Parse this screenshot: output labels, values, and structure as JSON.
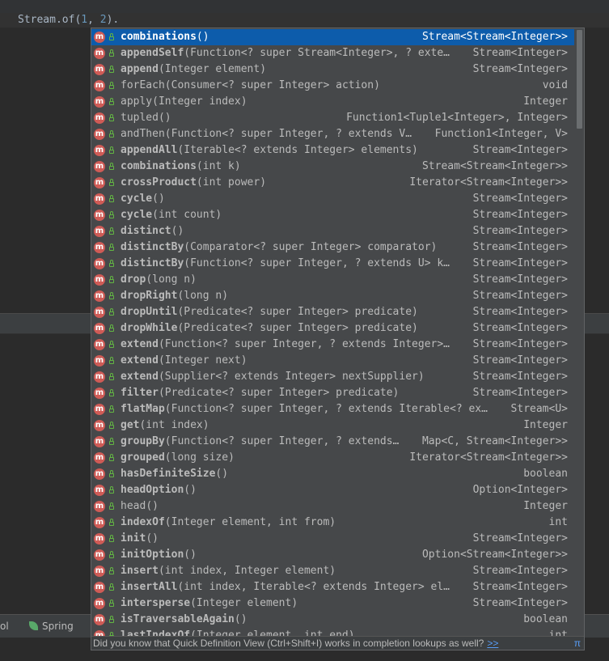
{
  "editor": {
    "code_prefix": "Stream.of(",
    "arg1": "1",
    "sep": ", ",
    "arg2": "2",
    "code_suffix": ")."
  },
  "bottom_tabs": [
    {
      "label": "ol"
    },
    {
      "label": "Spring",
      "icon": "spring-leaf-icon"
    }
  ],
  "completion": {
    "items": [
      {
        "name": "combinations",
        "params": "()",
        "ret": "Stream<Stream<Integer>>",
        "selected": true
      },
      {
        "name": "appendSelf",
        "params": "(Function<? super Stream<Integer>, ? exte…",
        "ret": "Stream<Integer>"
      },
      {
        "name": "append",
        "params": "(Integer element)",
        "ret": "Stream<Integer>"
      },
      {
        "name": "forEach",
        "params": "(Consumer<? super Integer> action)",
        "ret": "void",
        "plain": true
      },
      {
        "name": "apply",
        "params": "(Integer index)",
        "ret": "Integer",
        "plain": true
      },
      {
        "name": "tupled",
        "params": "()",
        "ret": "Function1<Tuple1<Integer>, Integer>",
        "plain": true
      },
      {
        "name": "andThen",
        "params": "(Function<? super Integer, ? extends V…",
        "ret": "Function1<Integer, V>",
        "plain": true
      },
      {
        "name": "appendAll",
        "params": "(Iterable<? extends Integer> elements)",
        "ret": "Stream<Integer>"
      },
      {
        "name": "combinations",
        "params": "(int k)",
        "ret": "Stream<Stream<Integer>>"
      },
      {
        "name": "crossProduct",
        "params": "(int power)",
        "ret": "Iterator<Stream<Integer>>"
      },
      {
        "name": "cycle",
        "params": "()",
        "ret": "Stream<Integer>"
      },
      {
        "name": "cycle",
        "params": "(int count)",
        "ret": "Stream<Integer>"
      },
      {
        "name": "distinct",
        "params": "()",
        "ret": "Stream<Integer>"
      },
      {
        "name": "distinctBy",
        "params": "(Comparator<? super Integer> comparator)",
        "ret": "Stream<Integer>"
      },
      {
        "name": "distinctBy",
        "params": "(Function<? super Integer, ? extends U> k…",
        "ret": "Stream<Integer>"
      },
      {
        "name": "drop",
        "params": "(long n)",
        "ret": "Stream<Integer>"
      },
      {
        "name": "dropRight",
        "params": "(long n)",
        "ret": "Stream<Integer>"
      },
      {
        "name": "dropUntil",
        "params": "(Predicate<? super Integer> predicate)",
        "ret": "Stream<Integer>"
      },
      {
        "name": "dropWhile",
        "params": "(Predicate<? super Integer> predicate)",
        "ret": "Stream<Integer>"
      },
      {
        "name": "extend",
        "params": "(Function<? super Integer, ? extends Integer>…",
        "ret": "Stream<Integer>"
      },
      {
        "name": "extend",
        "params": "(Integer next)",
        "ret": "Stream<Integer>"
      },
      {
        "name": "extend",
        "params": "(Supplier<? extends Integer> nextSupplier)",
        "ret": "Stream<Integer>"
      },
      {
        "name": "filter",
        "params": "(Predicate<? super Integer> predicate)",
        "ret": "Stream<Integer>"
      },
      {
        "name": "flatMap",
        "params": "(Function<? super Integer, ? extends Iterable<? ex…",
        "ret": "Stream<U>"
      },
      {
        "name": "get",
        "params": "(int index)",
        "ret": "Integer"
      },
      {
        "name": "groupBy",
        "params": "(Function<? super Integer, ? extends…",
        "ret": "Map<C, Stream<Integer>>"
      },
      {
        "name": "grouped",
        "params": "(long size)",
        "ret": "Iterator<Stream<Integer>>"
      },
      {
        "name": "hasDefiniteSize",
        "params": "()",
        "ret": "boolean"
      },
      {
        "name": "headOption",
        "params": "()",
        "ret": "Option<Integer>"
      },
      {
        "name": "head",
        "params": "()",
        "ret": "Integer",
        "plain": true
      },
      {
        "name": "indexOf",
        "params": "(Integer element, int from)",
        "ret": "int"
      },
      {
        "name": "init",
        "params": "()",
        "ret": "Stream<Integer>"
      },
      {
        "name": "initOption",
        "params": "()",
        "ret": "Option<Stream<Integer>>"
      },
      {
        "name": "insert",
        "params": "(int index, Integer element)",
        "ret": "Stream<Integer>"
      },
      {
        "name": "insertAll",
        "params": "(int index, Iterable<? extends Integer> el…",
        "ret": "Stream<Integer>"
      },
      {
        "name": "intersperse",
        "params": "(Integer element)",
        "ret": "Stream<Integer>"
      },
      {
        "name": "isTraversableAgain",
        "params": "()",
        "ret": "boolean"
      },
      {
        "name": "lastIndexOf",
        "params": "(Integer element, int end)",
        "ret": "int"
      }
    ],
    "hint_text": "Did you know that Quick Definition View (Ctrl+Shift+I) works in completion lookups as well?",
    "hint_link": ">>",
    "hint_symbol": "π"
  },
  "colors": {
    "selection": "#0d5cab",
    "popup_bg": "#46484a",
    "method_icon": "#cf5b56",
    "link": "#589df6"
  }
}
